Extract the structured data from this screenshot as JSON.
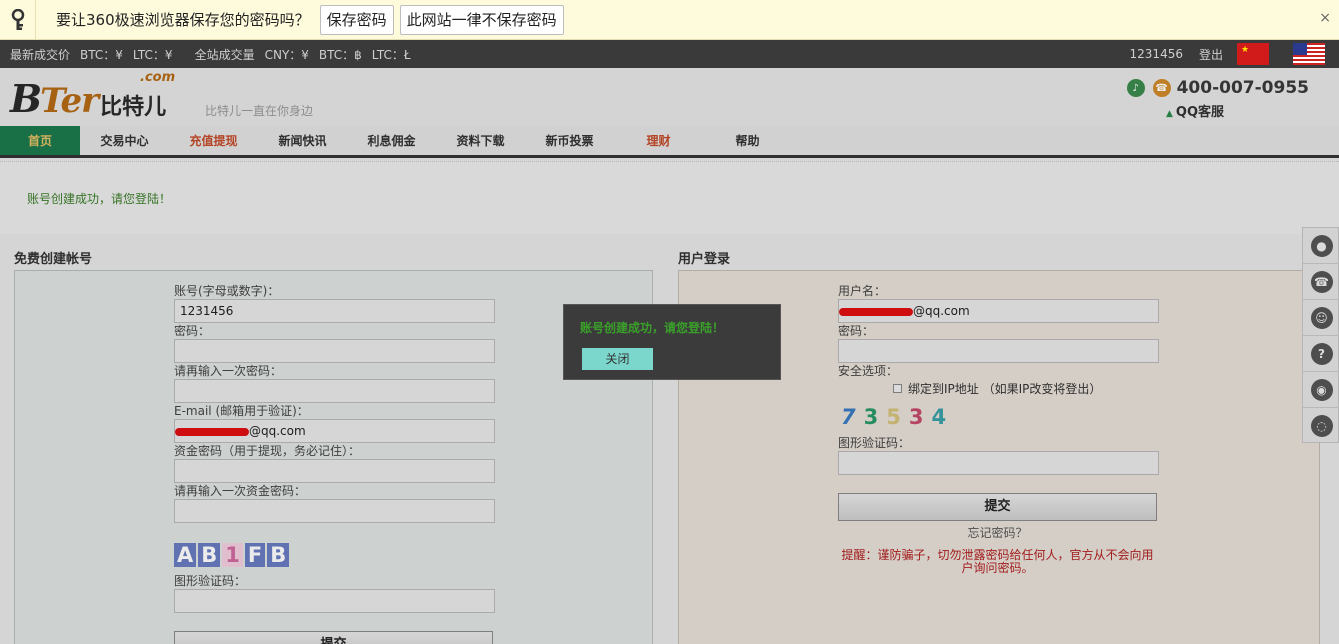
{
  "password_bar": {
    "message": "要让360极速浏览器保存您的密码吗？",
    "save_label": "保存密码",
    "never_label": "此网站一律不保存密码",
    "close_glyph": "×"
  },
  "topbar": {
    "latest_label": "最新成交价",
    "btc_price": "BTC：¥",
    "ltc_price": "LTC：¥",
    "volume_label": "全站成交量",
    "cny_volume": "CNY：¥",
    "btc_volume": "BTC：฿",
    "ltc_volume": "LTC：Ł",
    "username": "1231456",
    "logout": "登出"
  },
  "header": {
    "logo_b": "B",
    "logo_ter": "Ter",
    "logo_cn": "比特儿",
    "logo_com": ".com",
    "slogan": "比特儿一直在你身边",
    "phone": "400-007-0955",
    "qq_service": "QQ客服"
  },
  "nav": {
    "items": [
      "首页",
      "交易中心",
      "充值提现",
      "新闻快讯",
      "利息佣金",
      "资料下载",
      "新币投票",
      "理财",
      "帮助"
    ]
  },
  "notice": {
    "text": "账号创建成功，请您登陆！"
  },
  "register": {
    "title": "免费创建帐号",
    "account_label": "账号(字母或数字)：",
    "account_value": "1231456",
    "password_label": "密码：",
    "password_confirm_label": "请再输入一次密码：",
    "email_label": "E-mail (邮箱用于验证)：",
    "email_value": "@qq.com",
    "fund_password_label": "资金密码（用于提现，务必记住）：",
    "fund_password_confirm_label": "请再输入一次资金密码：",
    "captcha": [
      "A",
      "B",
      "1",
      "F",
      "B"
    ],
    "captcha_label": "图形验证码：",
    "submit_label": "提交"
  },
  "login": {
    "title": "用户登录",
    "username_label": "用户名：",
    "username_value": "@qq.com",
    "password_label": "密码：",
    "security_label": "安全选项：",
    "bind_ip_label": "绑定到IP地址 （如果IP改变将登出）",
    "captcha": [
      "7",
      "3",
      "5",
      "3",
      "4"
    ],
    "captcha_label": "图形验证码：",
    "submit_label": "提交",
    "forgot": "忘记密码？",
    "warning": "提醒：谨防骗子，切勿泄露密码给任何人，官方从不会向用户询问密码。"
  },
  "sidebar": {
    "icons": [
      "qq-icon",
      "phone-icon",
      "users-icon",
      "help-icon",
      "weibo-icon",
      "wechat-icon"
    ]
  },
  "modal": {
    "message": "账号创建成功，请您登陆！",
    "close_label": "关闭"
  },
  "colors": {
    "nav_active": "#1c7a4e",
    "notice_text": "#3b7d2a",
    "modal_btn": "#7bd7cc",
    "warning": "#b02020"
  }
}
